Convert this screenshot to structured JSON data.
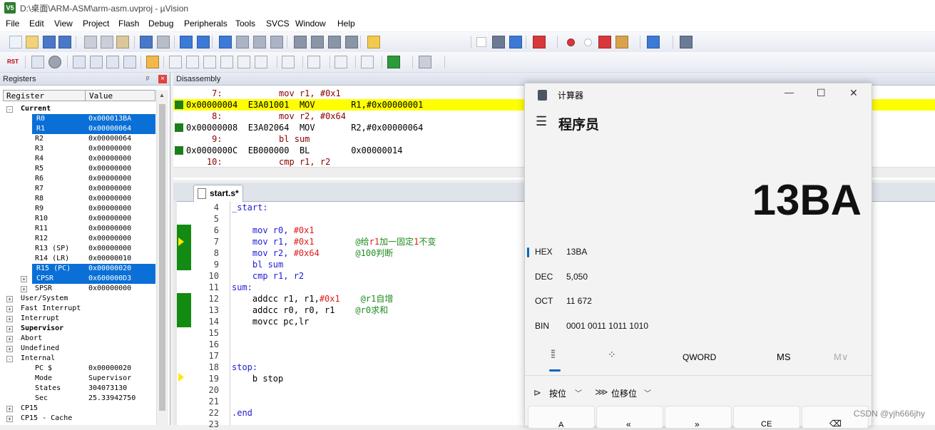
{
  "window": {
    "title": "D:\\桌面\\ARM-ASM\\arm-asm.uvproj - µVision",
    "icon_label": "V5"
  },
  "menu": [
    "File",
    "Edit",
    "View",
    "Project",
    "Flash",
    "Debug",
    "Peripherals",
    "Tools",
    "SVCS",
    "Window",
    "Help"
  ],
  "toolbar1": {
    "icons": [
      "new-file-icon",
      "open-icon",
      "save-icon",
      "save-all-icon",
      "cut-icon",
      "copy-icon",
      "paste-icon",
      "undo-icon",
      "redo-icon",
      "nav-back-icon",
      "nav-forward-icon",
      "bookmark-icon",
      "bookmark-prev-icon",
      "bookmark-next-icon",
      "bookmark-clear-icon",
      "indent-icon",
      "unindent-icon",
      "comment-icon",
      "uncomment-icon",
      "find-in-files-icon",
      "dropdown-icon",
      "find-icon",
      "incremental-find-icon",
      "debug-session-icon",
      "breakpoint-insert-icon",
      "breakpoint-disable-icon",
      "breakpoint-kill-icon",
      "breakpoint-all-icon",
      "window-layout-icon",
      "configure-icon"
    ]
  },
  "toolbar2": {
    "rst_label": "RST",
    "icons": [
      "reset-icon",
      "run-icon",
      "stop-icon",
      "step-in-icon",
      "step-over-icon",
      "step-out-icon",
      "run-to-cursor-icon",
      "show-next-statement-icon",
      "command-window-icon",
      "disassembly-window-icon",
      "symbols-window-icon",
      "registers-window-icon",
      "call-stack-icon",
      "watch-window-icon",
      "memory-window-icon",
      "serial-window-icon",
      "analysis-window-icon",
      "trace-window-icon",
      "system-viewer-icon",
      "toolbox-icon"
    ]
  },
  "registers": {
    "title": "Registers",
    "pin": "ᵖ",
    "close": "×",
    "col_register": "Register",
    "col_value": "Value",
    "rows": [
      {
        "name": "Current",
        "value": "",
        "indent": 1,
        "bold": true,
        "exp": "-",
        "sel": false
      },
      {
        "name": "R0",
        "value": "0x000013BA",
        "indent": 3,
        "sel": true
      },
      {
        "name": "R1",
        "value": "0x00000064",
        "indent": 3,
        "sel": true
      },
      {
        "name": "R2",
        "value": "0x00000064",
        "indent": 3,
        "sel": false
      },
      {
        "name": "R3",
        "value": "0x00000000",
        "indent": 3,
        "sel": false
      },
      {
        "name": "R4",
        "value": "0x00000000",
        "indent": 3,
        "sel": false
      },
      {
        "name": "R5",
        "value": "0x00000000",
        "indent": 3,
        "sel": false
      },
      {
        "name": "R6",
        "value": "0x00000000",
        "indent": 3,
        "sel": false
      },
      {
        "name": "R7",
        "value": "0x00000000",
        "indent": 3,
        "sel": false
      },
      {
        "name": "R8",
        "value": "0x00000000",
        "indent": 3,
        "sel": false
      },
      {
        "name": "R9",
        "value": "0x00000000",
        "indent": 3,
        "sel": false
      },
      {
        "name": "R10",
        "value": "0x00000000",
        "indent": 3,
        "sel": false
      },
      {
        "name": "R11",
        "value": "0x00000000",
        "indent": 3,
        "sel": false
      },
      {
        "name": "R12",
        "value": "0x00000000",
        "indent": 3,
        "sel": false
      },
      {
        "name": "R13 (SP)",
        "value": "0x00000000",
        "indent": 3,
        "sel": false
      },
      {
        "name": "R14 (LR)",
        "value": "0x00000010",
        "indent": 3,
        "sel": false
      },
      {
        "name": "R15 (PC)",
        "value": "0x00000020",
        "indent": 3,
        "sel": true
      },
      {
        "name": "CPSR",
        "value": "0x600000D3",
        "indent": 3,
        "sel": true,
        "exp": "+"
      },
      {
        "name": "SPSR",
        "value": "0x00000000",
        "indent": 3,
        "sel": false,
        "exp": "+"
      },
      {
        "name": "User/System",
        "value": "",
        "indent": 1,
        "exp": "+"
      },
      {
        "name": "Fast Interrupt",
        "value": "",
        "indent": 1,
        "exp": "+"
      },
      {
        "name": "Interrupt",
        "value": "",
        "indent": 1,
        "exp": "+"
      },
      {
        "name": "Supervisor",
        "value": "",
        "indent": 1,
        "bold": true,
        "exp": "+"
      },
      {
        "name": "Abort",
        "value": "",
        "indent": 1,
        "exp": "+"
      },
      {
        "name": "Undefined",
        "value": "",
        "indent": 1,
        "exp": "+"
      },
      {
        "name": "Internal",
        "value": "",
        "indent": 1,
        "exp": "-"
      },
      {
        "name": "PC  $",
        "value": "0x00000020",
        "indent": 3
      },
      {
        "name": "Mode",
        "value": "Supervisor",
        "indent": 3
      },
      {
        "name": "States",
        "value": "304073130",
        "indent": 3
      },
      {
        "name": "Sec",
        "value": "25.33942750",
        "indent": 3
      },
      {
        "name": "CP15",
        "value": "",
        "indent": 1,
        "exp": "+"
      },
      {
        "name": "CP15 - Cache",
        "value": "",
        "indent": 1,
        "exp": "+"
      }
    ]
  },
  "disassembly": {
    "title": "Disassembly",
    "rows": [
      {
        "text": "     7:           mov r1, #0x1",
        "src": true,
        "hl": false,
        "marker": false
      },
      {
        "text": "0x00000004  E3A01001  MOV       R1,#0x00000001",
        "src": false,
        "hl": true,
        "marker": true
      },
      {
        "text": "     8:           mov r2, #0x64",
        "src": true,
        "hl": false,
        "marker": false
      },
      {
        "text": "0x00000008  E3A02064  MOV       R2,#0x00000064",
        "src": false,
        "hl": false,
        "marker": true
      },
      {
        "text": "     9:           bl sum",
        "src": true,
        "hl": false,
        "marker": false
      },
      {
        "text": "0x0000000C  EB000000  BL        0x00000014",
        "src": false,
        "hl": false,
        "marker": true
      },
      {
        "text": "    10:           cmp r1, r2",
        "src": true,
        "hl": false,
        "marker": false
      }
    ]
  },
  "editor": {
    "tab": "start.s*",
    "lines": [
      {
        "n": "4",
        "parts": [
          [
            "lbl",
            "_start:"
          ]
        ]
      },
      {
        "n": "5",
        "parts": []
      },
      {
        "n": "6",
        "parts": [
          [
            "kw",
            "    mov r0, "
          ],
          [
            "num",
            "#0x1"
          ]
        ]
      },
      {
        "n": "7",
        "parts": [
          [
            "kw",
            "    mov r1, "
          ],
          [
            "num",
            "#0x1"
          ],
          [
            "plain",
            "        "
          ],
          [
            "cmt",
            "@给"
          ],
          [
            "num",
            "r1"
          ],
          [
            "cmt",
            "加一固定"
          ],
          [
            "num",
            "1"
          ],
          [
            "cmt",
            "不变"
          ]
        ]
      },
      {
        "n": "8",
        "parts": [
          [
            "kw",
            "    mov r2, "
          ],
          [
            "num",
            "#0x64"
          ],
          [
            "plain",
            "       "
          ],
          [
            "cmt",
            "@100判断"
          ]
        ]
      },
      {
        "n": "9",
        "parts": [
          [
            "kw",
            "    bl sum"
          ]
        ]
      },
      {
        "n": "10",
        "parts": [
          [
            "kw",
            "    cmp r1, r2"
          ]
        ]
      },
      {
        "n": "11",
        "parts": [
          [
            "lbl",
            "sum:"
          ]
        ]
      },
      {
        "n": "12",
        "parts": [
          [
            "plain",
            "    addcc r1, r1,"
          ],
          [
            "num",
            "#0x1"
          ],
          [
            "plain",
            "    "
          ],
          [
            "cmt",
            "@r1自增"
          ]
        ]
      },
      {
        "n": "13",
        "parts": [
          [
            "plain",
            "    addcc r0, r0, r1    "
          ],
          [
            "cmt",
            "@r0求和"
          ]
        ]
      },
      {
        "n": "14",
        "parts": [
          [
            "plain",
            "    movcc pc,lr"
          ]
        ]
      },
      {
        "n": "15",
        "parts": []
      },
      {
        "n": "16",
        "parts": []
      },
      {
        "n": "17",
        "parts": []
      },
      {
        "n": "18",
        "parts": [
          [
            "lbl",
            "stop:"
          ]
        ]
      },
      {
        "n": "19",
        "parts": [
          [
            "plain",
            "    b stop"
          ]
        ]
      },
      {
        "n": "20",
        "parts": []
      },
      {
        "n": "21",
        "parts": []
      },
      {
        "n": "22",
        "parts": [
          [
            "lbl",
            ".end"
          ]
        ]
      },
      {
        "n": "23",
        "parts": []
      }
    ]
  },
  "calculator": {
    "title": "计算器",
    "mode": "程序员",
    "display": "13BA",
    "bases": [
      {
        "label": "HEX",
        "value": "13BA",
        "active": true
      },
      {
        "label": "DEC",
        "value": "5,050",
        "active": false
      },
      {
        "label": "OCT",
        "value": "11 672",
        "active": false
      },
      {
        "label": "BIN",
        "value": "0001 0011 1011 1010",
        "active": false
      }
    ],
    "word_size": "QWORD",
    "memory_store": "MS",
    "memory_menu": "M∨",
    "bitwise": "按位",
    "bitshift": "位移位",
    "minimize": "—",
    "maximize": "☐",
    "close": "✕",
    "hamburger": "☰",
    "key_labels": [
      "A",
      "«",
      "»",
      "CE",
      "⌫"
    ]
  },
  "watermark": "CSDN @yjh666jhy"
}
